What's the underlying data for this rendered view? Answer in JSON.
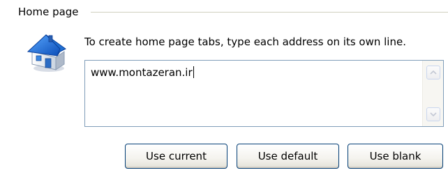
{
  "home_page": {
    "group_label": "Home page",
    "instructions": "To create home page tabs, type each address on its own line.",
    "address_value": "www.montazeran.ir",
    "icon": "house-icon"
  },
  "scrollbar": {
    "up_icon": "scroll-up-arrow-icon",
    "down_icon": "scroll-down-arrow-icon"
  },
  "buttons": {
    "use_current": "Use current",
    "use_default": "Use default",
    "use_blank": "Use blank"
  },
  "colors": {
    "group_line": "#d0d0bf",
    "textbox_border": "#7f9db9",
    "button_border": "#003c74",
    "house_roof": "#1f6fd1",
    "house_wall": "#ffffff"
  }
}
